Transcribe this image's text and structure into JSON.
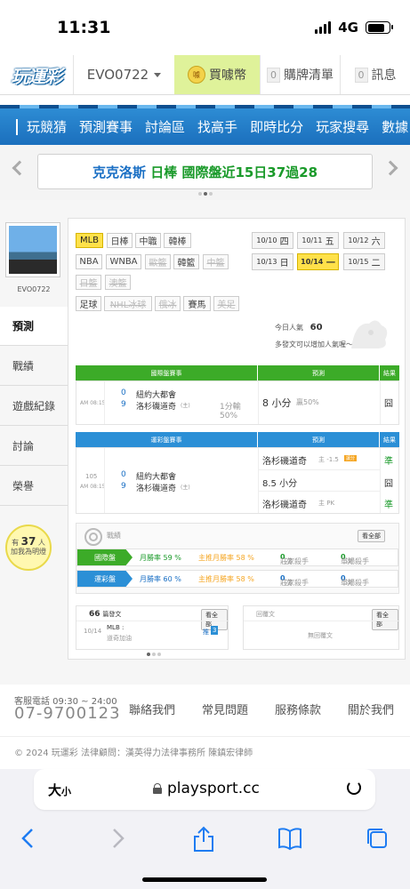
{
  "status_bar": {
    "time": "11:31",
    "network": "4G"
  },
  "top_nav": {
    "logo": "玩運彩",
    "account": "EVO0722",
    "buy_coins": "買噱幣",
    "purchase_list": {
      "count": "0",
      "label": "購牌清單"
    },
    "messages": {
      "count": "0",
      "label": "訊息"
    }
  },
  "main_nav": [
    "玩競猜",
    "預測賽事",
    "討論區",
    "找高手",
    "即時比分",
    "玩家搜尋",
    "數據"
  ],
  "ticker": {
    "team": "克克洛斯",
    "league": "日棒",
    "text": "國際盤近15日37過28"
  },
  "sidebar": {
    "username": "EVO0722",
    "items": [
      "預測",
      "戰績",
      "遊戲紀錄",
      "討論",
      "榮譽"
    ],
    "active": "預測",
    "bulb": {
      "prefix": "有",
      "count": "37",
      "unit": "人",
      "suffix": "加我為明燈"
    }
  },
  "leagues": [
    {
      "label": "MLB",
      "state": "on"
    },
    {
      "label": "日棒",
      "state": "normal"
    },
    {
      "label": "中職",
      "state": "normal"
    },
    {
      "label": "韓棒",
      "state": "normal"
    },
    {
      "label": "NBA",
      "state": "normal"
    },
    {
      "label": "WNBA",
      "state": "normal"
    },
    {
      "label": "歐籃",
      "state": "off"
    },
    {
      "label": "韓籃",
      "state": "normal"
    },
    {
      "label": "中籃",
      "state": "off"
    },
    {
      "label": "日籃",
      "state": "off"
    },
    {
      "label": "澳籃",
      "state": "off"
    },
    {
      "label": "足球",
      "state": "normal"
    },
    {
      "label": "NHL冰球",
      "state": "off"
    },
    {
      "label": "俄冰",
      "state": "off"
    },
    {
      "label": "賽馬",
      "state": "normal"
    },
    {
      "label": "美足",
      "state": "off"
    }
  ],
  "dates": [
    {
      "md": "10/10",
      "dow": "四",
      "active": false
    },
    {
      "md": "10/11",
      "dow": "五",
      "active": false
    },
    {
      "md": "10/12",
      "dow": "六",
      "active": false
    },
    {
      "md": "10/13",
      "dow": "日",
      "active": false
    },
    {
      "md": "10/14",
      "dow": "一",
      "active": true
    },
    {
      "md": "10/15",
      "dow": "二",
      "active": false
    }
  ],
  "popularity": {
    "label": "今日人氣",
    "value": "60",
    "note": "多發文可以增加人氣喔～"
  },
  "intl_table": {
    "headers": [
      "國際盤賽事",
      "預測",
      "結果"
    ],
    "time": "AM 08:15",
    "team1": {
      "score": "0",
      "name": "紐約大都會"
    },
    "team2": {
      "score": "9",
      "name": "洛杉磯道奇",
      "tag": "(主)"
    },
    "line": "1分輸",
    "line_pct": "50%",
    "prediction": "8 小分",
    "prediction_note": "贏50%",
    "result": "囧"
  },
  "lottery_table": {
    "headers": [
      "運彩盤賽事",
      "預測",
      "結果"
    ],
    "game_no": "105",
    "time": "AM 08:15",
    "team1": {
      "score": "0",
      "name": "紐約大都會"
    },
    "team2": {
      "score": "9",
      "name": "洛杉磯道奇",
      "tag": "(主)"
    },
    "predictions": [
      {
        "text": "洛杉磯道奇",
        "note": "主 -1.5",
        "badge": "讓分",
        "result": "準"
      },
      {
        "text": "8.5 小分",
        "note": "",
        "badge": "",
        "result": "囧"
      },
      {
        "text": "洛杉磯道奇",
        "note": "主 PK",
        "badge": "",
        "result": "準"
      }
    ]
  },
  "stats": {
    "title": "戰績",
    "view_all": "看全部",
    "rows": [
      {
        "label": "國際盤",
        "month_win": "月勝率 59 %",
        "home_win": "主推月勝率 58 %",
        "kill": "莊家殺手",
        "kill_n": "0",
        "kill_u": "次",
        "single": "單場殺手",
        "single_n": "0",
        "single_u": "次"
      },
      {
        "label": "運彩盤",
        "month_win": "月勝率 60 %",
        "home_win": "主推月勝率 58 %",
        "kill": "莊家殺手",
        "kill_n": "0",
        "kill_u": "次",
        "single": "單場殺手",
        "single_n": "0",
        "single_u": "次"
      }
    ]
  },
  "posts": {
    "count": "66",
    "title": "篇發文",
    "view_all": "看全部",
    "item": {
      "date": "10/14",
      "cat": "MLB :",
      "text": "道奇加油",
      "push": "推",
      "push_n": "3"
    },
    "reply_title": "回覆文",
    "reply_view_all": "看全部",
    "reply_empty": "無回覆文"
  },
  "footer": {
    "hours": "客服電話 09:30 ~ 24:00",
    "phone": "07-9700123",
    "links": [
      "聯絡我們",
      "常見問題",
      "服務條款",
      "關於我們"
    ],
    "copyright": "© 2024 玩運彩 法律顧問：漢英得力法律事務所 陳鎮宏律師"
  },
  "safari": {
    "aa": "大",
    "aa_small": "小",
    "url": "playsport.cc"
  }
}
